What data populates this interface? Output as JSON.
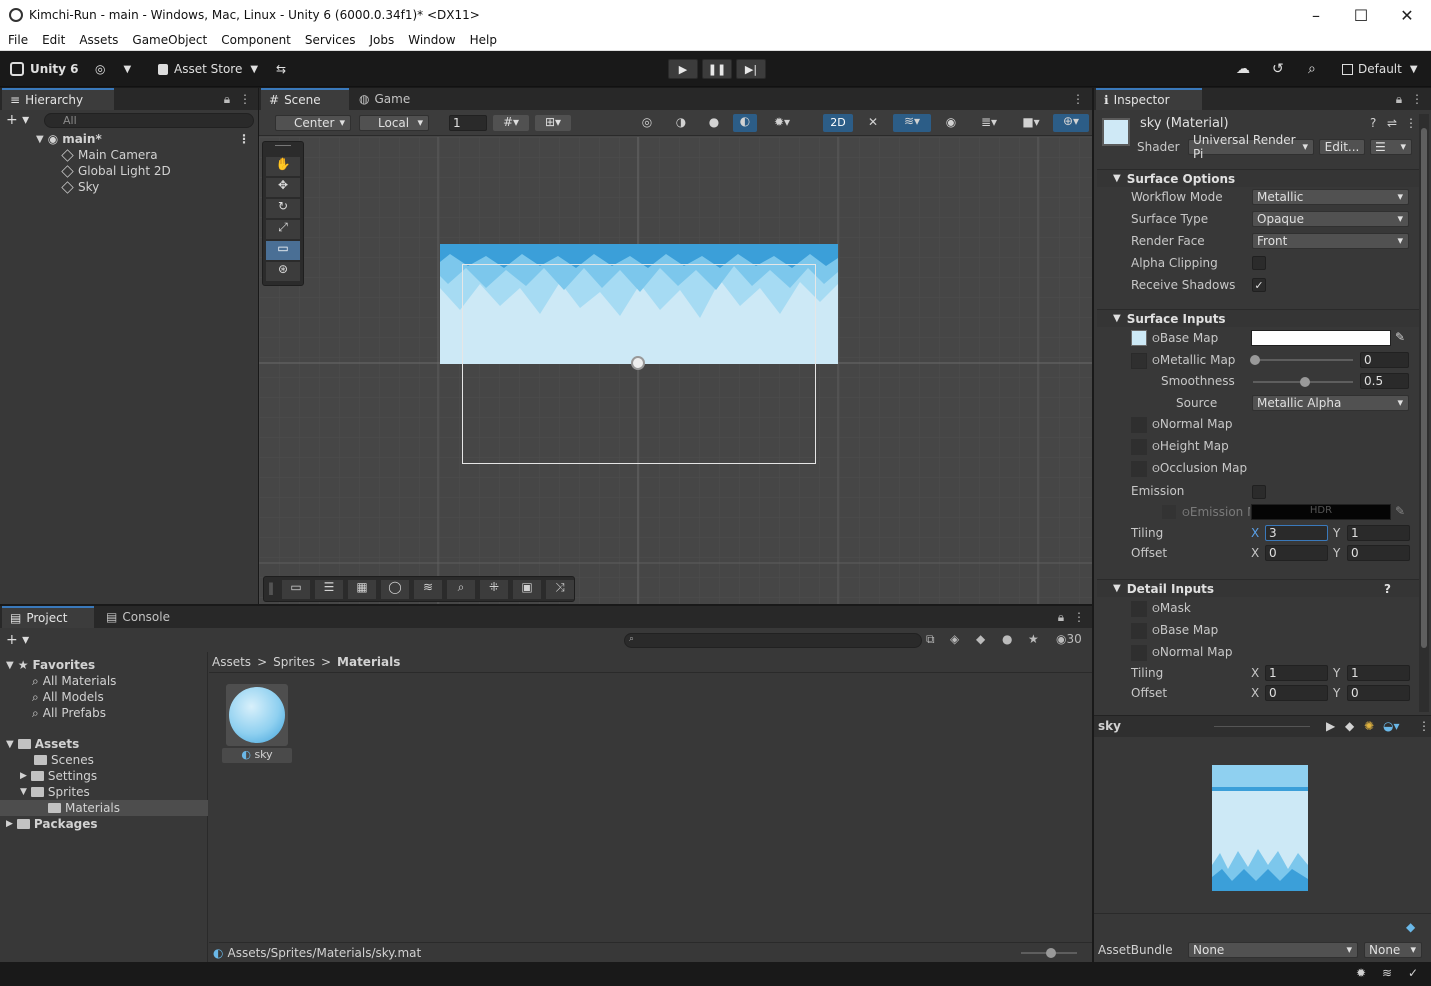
{
  "window": {
    "title": "Kimchi-Run - main - Windows, Mac, Linux - Unity 6 (6000.0.34f1)* <DX11>"
  },
  "menu": [
    "File",
    "Edit",
    "Assets",
    "GameObject",
    "Component",
    "Services",
    "Jobs",
    "Window",
    "Help"
  ],
  "toolbar": {
    "unity_label": "Unity 6",
    "account_label": "◎",
    "asset_store": "Asset Store",
    "layout": "Default"
  },
  "hierarchy": {
    "tab": "Hierarchy",
    "search_placeholder": "All",
    "scene": "main*",
    "items": [
      "Main Camera",
      "Global Light 2D",
      "Sky"
    ]
  },
  "scene_view": {
    "tabs": [
      "Scene",
      "Game"
    ],
    "pivot": "Center",
    "space": "Local",
    "grid_value": "1",
    "mode2d": "2D"
  },
  "inspector": {
    "tab": "Inspector",
    "object": "sky (Material)",
    "shader_label": "Shader",
    "shader_value": "Universal Render Pi",
    "edit_label": "Edit...",
    "surface_options": {
      "title": "Surface Options",
      "rows": [
        {
          "label": "Workflow Mode",
          "value": "Metallic"
        },
        {
          "label": "Surface Type",
          "value": "Opaque"
        },
        {
          "label": "Render Face",
          "value": "Front"
        }
      ],
      "alpha_clipping": "Alpha Clipping",
      "receive_shadows": "Receive Shadows"
    },
    "surface_inputs": {
      "title": "Surface Inputs",
      "base_map": "Base Map",
      "metallic_map": "Metallic Map",
      "metallic_value": "0",
      "smoothness": "Smoothness",
      "smoothness_value": "0.5",
      "source": "Source",
      "source_value": "Metallic Alpha",
      "normal_map": "Normal Map",
      "height_map": "Height Map",
      "occlusion_map": "Occlusion Map",
      "emission": "Emission",
      "emission_map": "Emission M",
      "hdr": "HDR",
      "tiling": "Tiling",
      "tiling_x": "3",
      "tiling_y": "1",
      "offset": "Offset",
      "offset_x": "0",
      "offset_y": "0"
    },
    "detail_inputs": {
      "title": "Detail Inputs",
      "mask": "Mask",
      "base_map": "Base Map",
      "normal_map": "Normal Map",
      "tiling": "Tiling",
      "tiling_x": "1",
      "tiling_y": "1",
      "offset": "Offset",
      "offset_x": "0",
      "offset_y": "0"
    },
    "x_label": "X",
    "y_label": "Y",
    "preview_title": "sky",
    "assetbundle_label": "AssetBundle",
    "assetbundle_value": "None",
    "assetbundle_variant": "None",
    "metallic_slider": 0.0,
    "smoothness_slider": 0.5
  },
  "project": {
    "tabs": [
      "Project",
      "Console"
    ],
    "count": "30",
    "favorites_title": "Favorites",
    "favorites": [
      "All Materials",
      "All Models",
      "All Prefabs"
    ],
    "assets_title": "Assets",
    "assets": [
      "Scenes",
      "Settings",
      "Sprites",
      "Materials"
    ],
    "packages": "Packages",
    "breadcrumb": [
      "Assets",
      "Sprites",
      "Materials"
    ],
    "asset_item": "sky",
    "status_path": "Assets/Sprites/Materials/sky.mat"
  },
  "colors": {
    "accent": "#3a79bb",
    "sky_light": "#cde9f6",
    "sky_mid": "#8fd0f0",
    "sky_dark": "#3b9fd9"
  }
}
